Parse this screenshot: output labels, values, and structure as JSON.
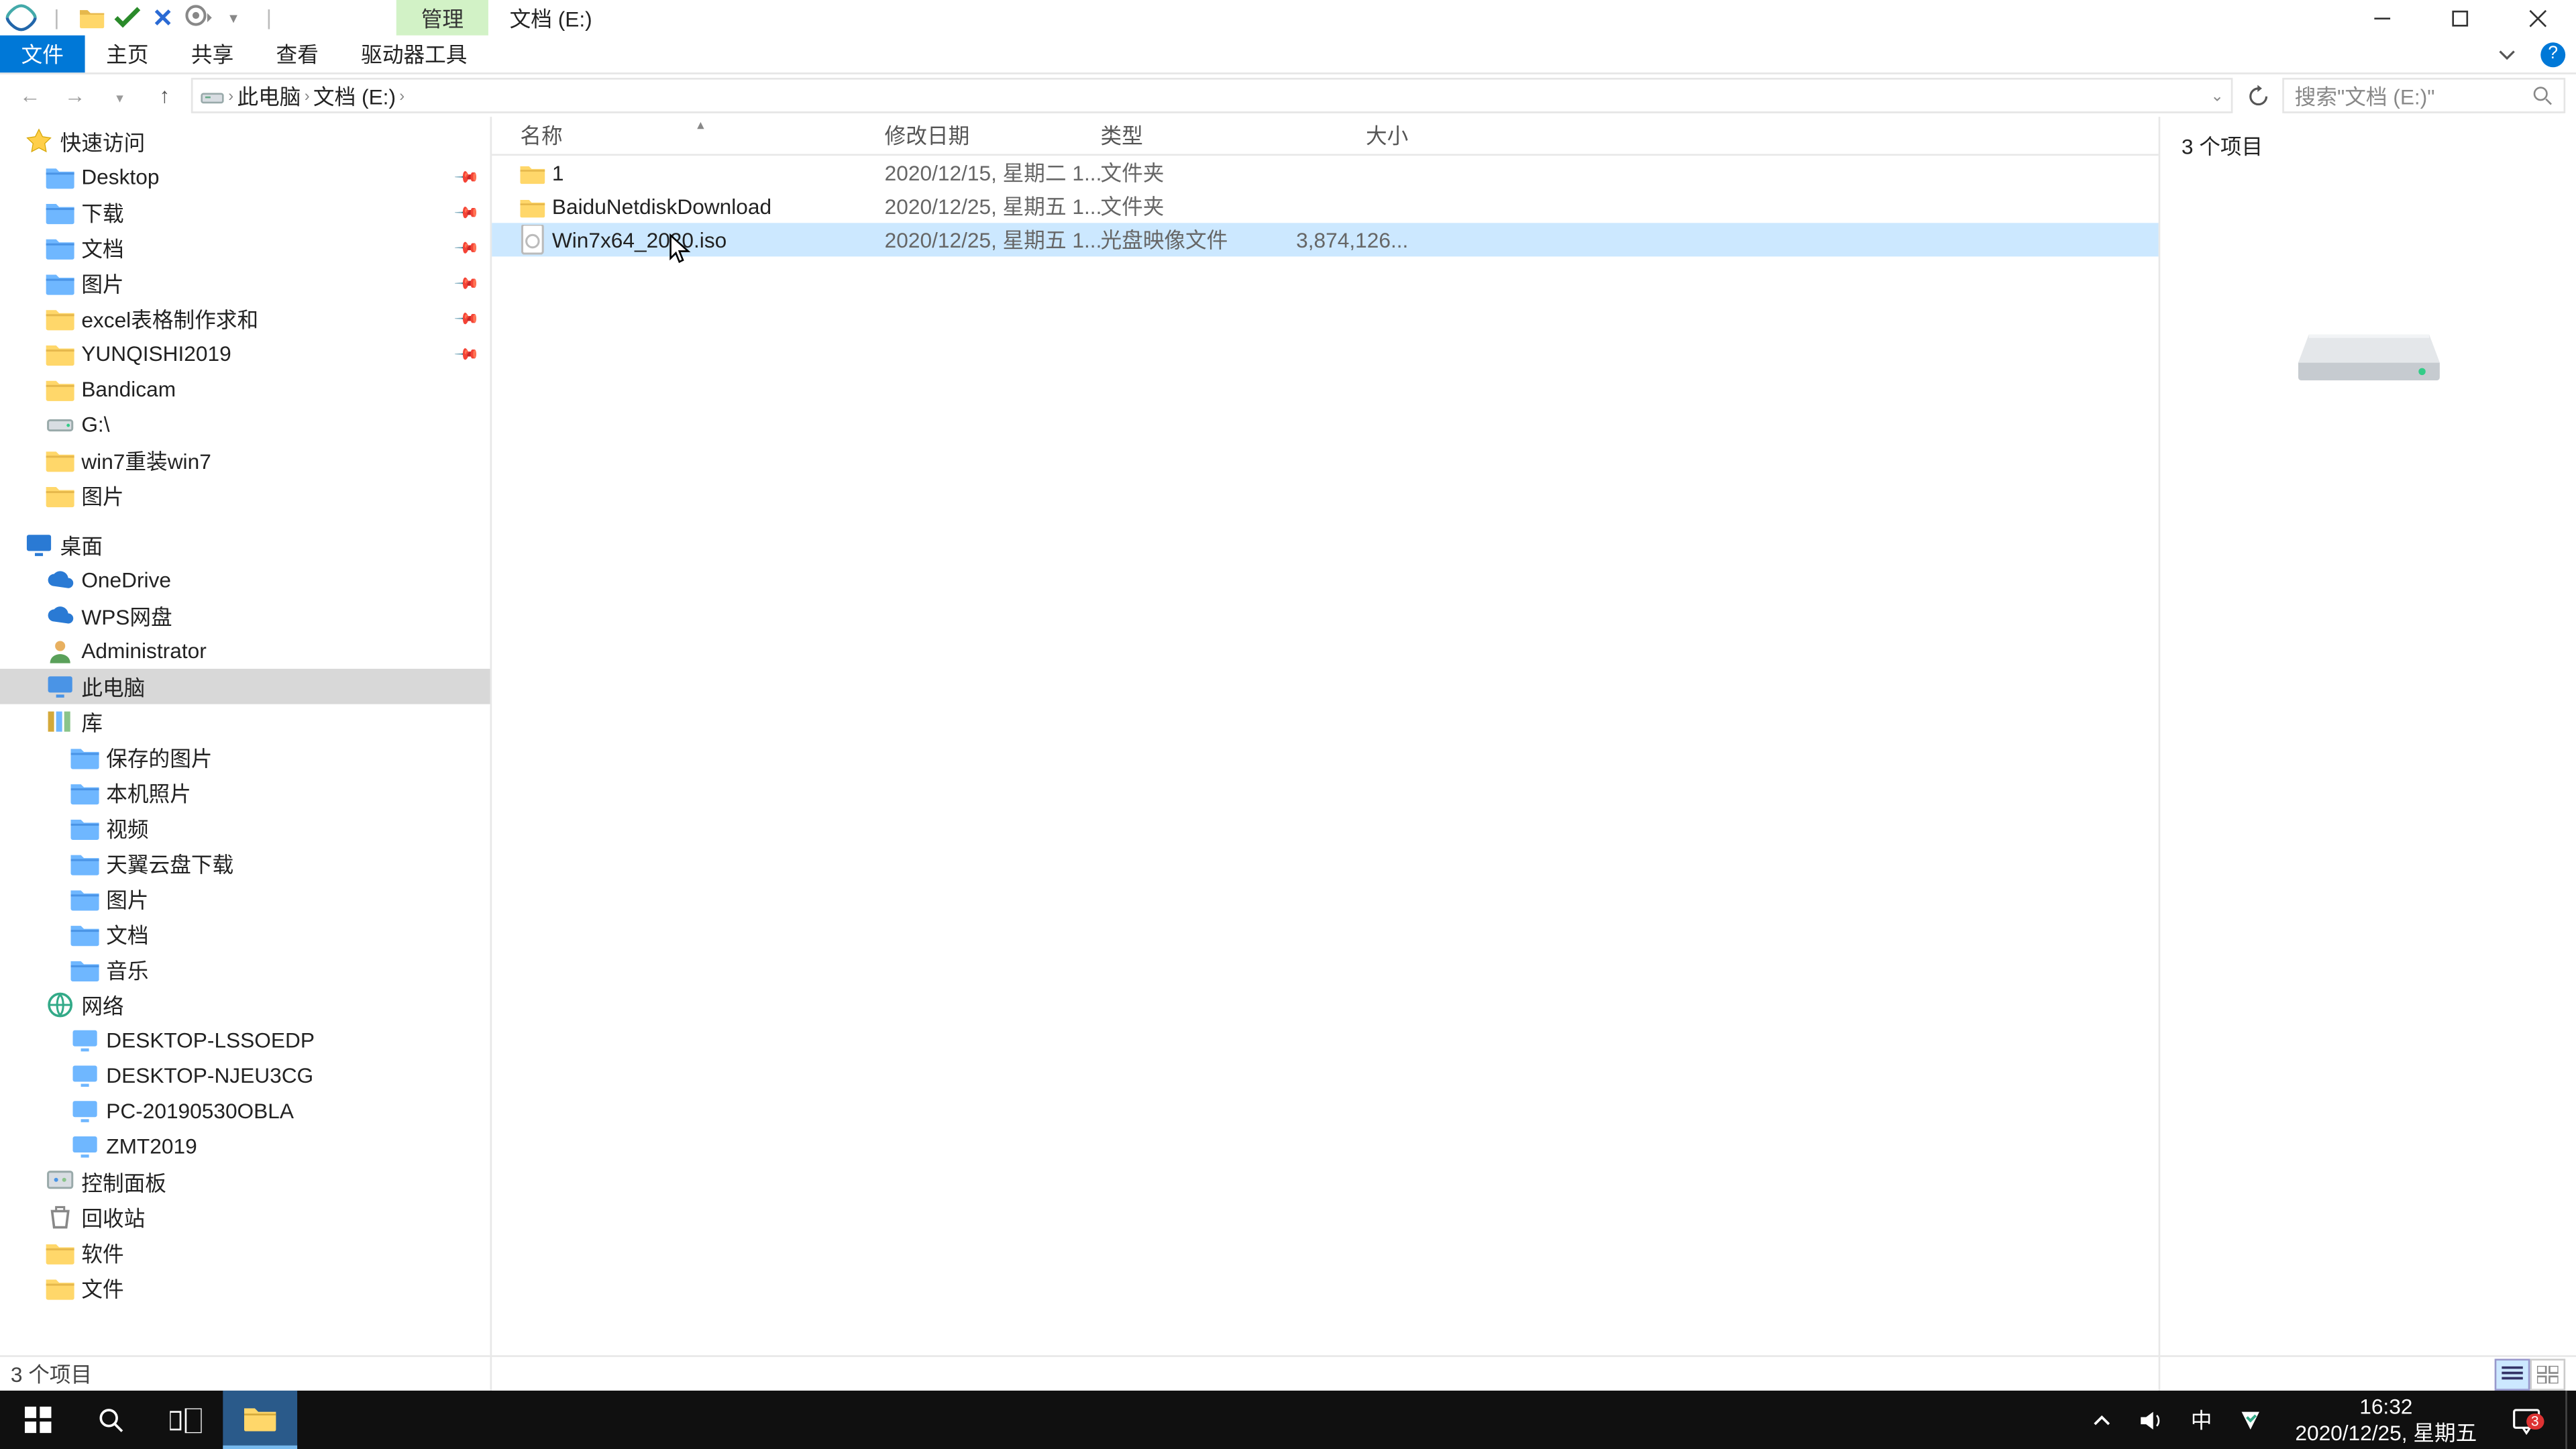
{
  "titlebar": {
    "context_tab": "管理",
    "title": "文档 (E:)"
  },
  "ribbon": {
    "file": "文件",
    "home": "主页",
    "share": "共享",
    "view": "查看",
    "drive_tools": "驱动器工具"
  },
  "path": {
    "segments": [
      "此电脑",
      "文档 (E:)"
    ]
  },
  "search": {
    "placeholder": "搜索\"文档 (E:)\""
  },
  "columns": {
    "name": "名称",
    "date": "修改日期",
    "type": "类型",
    "size": "大小"
  },
  "rows": [
    {
      "name": "1",
      "date": "2020/12/15, 星期二 1...",
      "type": "文件夹",
      "size": "",
      "icon": "folder",
      "selected": false
    },
    {
      "name": "BaiduNetdiskDownload",
      "date": "2020/12/25, 星期五 1...",
      "type": "文件夹",
      "size": "",
      "icon": "folder",
      "selected": false
    },
    {
      "name": "Win7x64_2020.iso",
      "date": "2020/12/25, 星期五 1...",
      "type": "光盘映像文件",
      "size": "3,874,126...",
      "icon": "iso",
      "selected": true
    }
  ],
  "tree": {
    "quick_access": "快速访问",
    "quick_items": [
      {
        "label": "Desktop",
        "icon": "folder-blue",
        "pinned": true
      },
      {
        "label": "下载",
        "icon": "folder-blue",
        "pinned": true
      },
      {
        "label": "文档",
        "icon": "folder-blue",
        "pinned": true
      },
      {
        "label": "图片",
        "icon": "folder-blue",
        "pinned": true
      },
      {
        "label": "excel表格制作求和",
        "icon": "folder-yellow",
        "pinned": true
      },
      {
        "label": "YUNQISHI2019",
        "icon": "folder-yellow",
        "pinned": true
      },
      {
        "label": "Bandicam",
        "icon": "folder-yellow"
      },
      {
        "label": "G:\\",
        "icon": "drive"
      },
      {
        "label": "win7重装win7",
        "icon": "folder-yellow"
      },
      {
        "label": "图片",
        "icon": "folder-yellow"
      }
    ],
    "desktop": "桌面",
    "desktop_items": [
      {
        "label": "OneDrive",
        "icon": "cloud-blue"
      },
      {
        "label": "WPS网盘",
        "icon": "cloud-blue"
      },
      {
        "label": "Administrator",
        "icon": "user"
      },
      {
        "label": "此电脑",
        "icon": "pc",
        "selected": true
      },
      {
        "label": "库",
        "icon": "library"
      }
    ],
    "library_items": [
      {
        "label": "保存的图片",
        "icon": "folder-blue"
      },
      {
        "label": "本机照片",
        "icon": "folder-blue"
      },
      {
        "label": "视频",
        "icon": "folder-blue"
      },
      {
        "label": "天翼云盘下载",
        "icon": "folder-blue"
      },
      {
        "label": "图片",
        "icon": "folder-blue"
      },
      {
        "label": "文档",
        "icon": "folder-blue"
      },
      {
        "label": "音乐",
        "icon": "folder-blue"
      }
    ],
    "network": "网络",
    "network_items": [
      {
        "label": "DESKTOP-LSSOEDP",
        "icon": "pc-net"
      },
      {
        "label": "DESKTOP-NJEU3CG",
        "icon": "pc-net"
      },
      {
        "label": "PC-20190530OBLA",
        "icon": "pc-net"
      },
      {
        "label": "ZMT2019",
        "icon": "pc-net"
      }
    ],
    "extra": [
      {
        "label": "控制面板",
        "icon": "panel"
      },
      {
        "label": "回收站",
        "icon": "recycle"
      },
      {
        "label": "软件",
        "icon": "folder-yellow"
      },
      {
        "label": "文件",
        "icon": "folder-yellow"
      }
    ]
  },
  "preview": {
    "count": "3 个项目"
  },
  "status": {
    "count": "3 个项目"
  },
  "tray": {
    "ime": "中",
    "time": "16:32",
    "date": "2020/12/25, 星期五",
    "notif_count": "3"
  }
}
